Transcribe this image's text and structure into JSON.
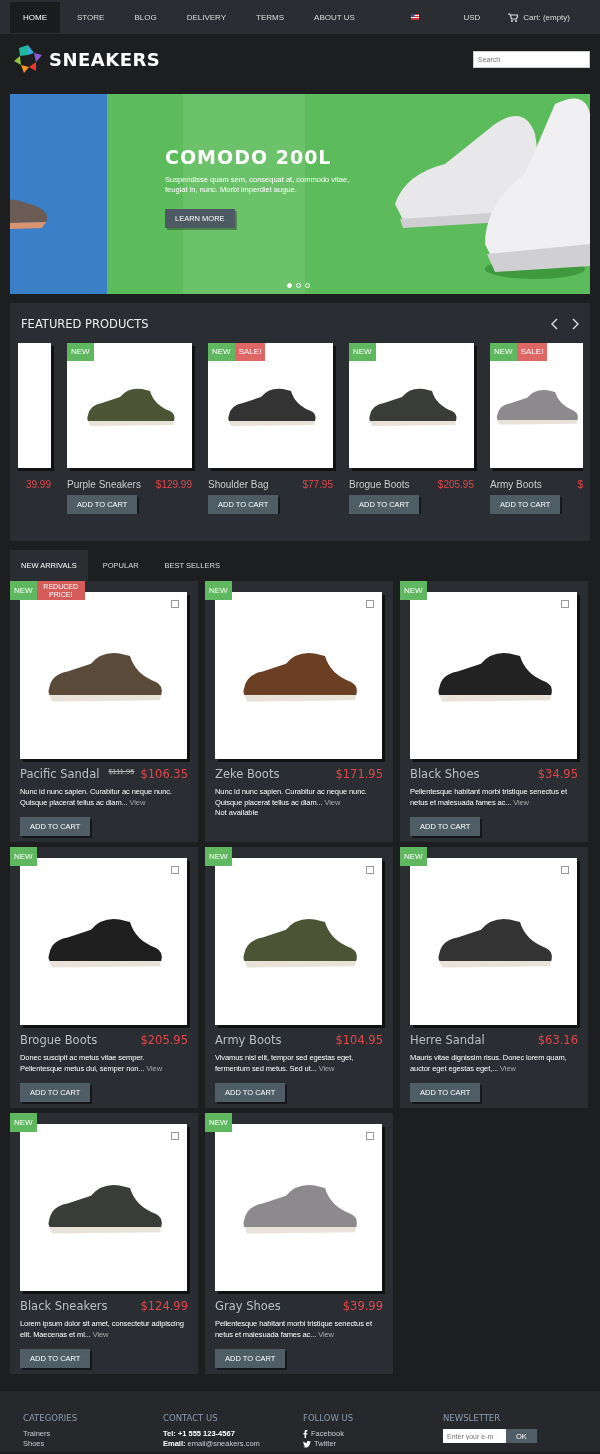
{
  "nav": {
    "items": [
      {
        "label": "HOME",
        "selected": true
      },
      {
        "label": "STORE",
        "selected": false
      },
      {
        "label": "BLOG",
        "selected": false
      },
      {
        "label": "DELIVERY",
        "selected": false
      },
      {
        "label": "TERMS",
        "selected": false
      },
      {
        "label": "ABOUT US",
        "selected": false
      }
    ],
    "currency": "USD",
    "cart": "Cart: (empty)"
  },
  "header": {
    "logo": "SNEAKERS",
    "search": {
      "placeholder": "Search"
    }
  },
  "hero": {
    "title": "COMODO 200L",
    "text": "Suspendisse quam sem, consequat at, commodo vitae, feugiat in, nunc. Morbi imperdiet augue.",
    "button": "LEARN MORE",
    "dots": [
      {
        "selected": true
      },
      {
        "selected": false
      },
      {
        "selected": false
      }
    ]
  },
  "featured": {
    "title": "FEATURED PRODUCTS",
    "products": [
      {
        "price": "39.99"
      },
      {
        "badges": [
          {
            "kind": "new",
            "label": "NEW"
          }
        ],
        "name": "Purple Sneakers",
        "price": "$129.99",
        "button": "ADD TO CART"
      },
      {
        "badges": [
          {
            "kind": "new",
            "label": "NEW"
          },
          {
            "kind": "sale",
            "label": "SALE!"
          }
        ],
        "name": "Shoulder Bag",
        "price": "$77.95",
        "button": "ADD TO CART"
      },
      {
        "badges": [
          {
            "kind": "new",
            "label": "NEW"
          }
        ],
        "name": "Brogue Boots",
        "price": "$205.95",
        "button": "ADD TO CART"
      },
      {
        "badges": [
          {
            "kind": "new",
            "label": "NEW"
          },
          {
            "kind": "sale",
            "label": "SALE!"
          }
        ],
        "name": "Army Boots",
        "price": "$",
        "button": "ADD TO CART"
      }
    ]
  },
  "tabs": [
    {
      "label": "NEW ARRIVALS",
      "selected": true
    },
    {
      "label": "POPULAR",
      "selected": false
    },
    {
      "label": "BEST SELLERS",
      "selected": false
    }
  ],
  "products": [
    {
      "badges": [
        {
          "kind": "new",
          "label": "NEW"
        },
        {
          "kind": "reduced",
          "label": "REDUCED PRICE!"
        }
      ],
      "compare_checked": false,
      "name": "Pacific Sandal",
      "old_price": "$111.95",
      "price": "$106.35",
      "description": "Nunc id nunc sapien. Curabitur ac neque nunc. Quisque placerat tellus ac diam...",
      "link": "View",
      "button": "ADD TO CART"
    },
    {
      "badges": [
        {
          "kind": "new",
          "label": "NEW"
        }
      ],
      "compare_checked": false,
      "name": "Zeke Boots",
      "price": "$171.95",
      "description": "Nunc id nunc sapien. Curabitur ac neque nunc. Quisque placerat tellus ac diam...",
      "link": "View",
      "availability": "Not available"
    },
    {
      "badges": [
        {
          "kind": "new",
          "label": "NEW"
        }
      ],
      "compare_checked": false,
      "name": "Black Shoes",
      "price": "$34.95",
      "description": "Pellentesque habitant morbi tristique senectus et netus et malesuada fames ac...",
      "link": "View",
      "button": "ADD TO CART"
    },
    {
      "badges": [
        {
          "kind": "new",
          "label": "NEW"
        }
      ],
      "compare_checked": false,
      "name": "Brogue Boots",
      "price": "$205.95",
      "description": "Donec suscipit ac metus vitae semper. Pellentesque metus dui, semper non...",
      "link": "View",
      "button": "ADD TO CART"
    },
    {
      "badges": [
        {
          "kind": "new",
          "label": "NEW"
        }
      ],
      "compare_checked": false,
      "name": "Army Boots",
      "price": "$104.95",
      "description": "Vivamus nisl elit, tempor sed egestas eget, fermentum sed metus. Sed ut...",
      "link": "View",
      "button": "ADD TO CART"
    },
    {
      "badges": [
        {
          "kind": "new",
          "label": "NEW"
        }
      ],
      "compare_checked": false,
      "name": "Herre Sandal",
      "price": "$63.16",
      "description": "Mauris vitae dignissim risus. Donec lorem quam, auctor eget egestas eget,...",
      "link": "View",
      "button": "ADD TO CART"
    },
    {
      "badges": [
        {
          "kind": "new",
          "label": "NEW"
        }
      ],
      "compare_checked": false,
      "name": "Black Sneakers",
      "price": "$124.99",
      "description": "Lorem ipsum dolor sit amet, consectetur adipiscing elit. Maecenas et mi...",
      "link": "View",
      "button": "ADD TO CART"
    },
    {
      "badges": [
        {
          "kind": "new",
          "label": "NEW"
        }
      ],
      "compare_checked": false,
      "name": "Gray Shoes",
      "price": "$39.99",
      "description": "Pellentesque habitant morbi tristique senectus et netus et malesuada fames ac...",
      "link": "View",
      "button": "ADD TO CART"
    }
  ],
  "footer": {
    "categories": {
      "title": "CATEGORIES",
      "items": [
        "Trainers",
        "Shoes"
      ]
    },
    "contact": {
      "title": "CONTACT US",
      "lines": [
        {
          "kind": "text",
          "label": "Tel:",
          "value": "+1 555 123-4567"
        },
        {
          "kind": "link",
          "label": "Email:",
          "value": "email@sneakers.com"
        }
      ]
    },
    "follow": {
      "title": "FOLLOW US",
      "links": [
        {
          "kind": "facebook",
          "label": "Facebook"
        },
        {
          "kind": "twitter",
          "label": "Twitter"
        }
      ]
    },
    "newsletter": {
      "title": "NEWSLETTER",
      "placeholder": "Enter your e-m",
      "button": "OK"
    }
  }
}
